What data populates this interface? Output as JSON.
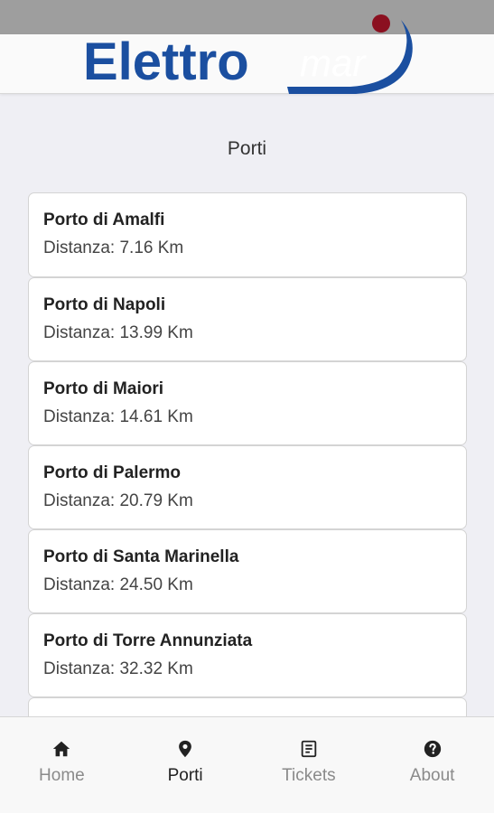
{
  "app": {
    "brand_part1": "Elettro",
    "brand_part2": "mar"
  },
  "page": {
    "title": "Porti"
  },
  "ports": [
    {
      "name": "Porto di Amalfi",
      "distance": "Distanza: 7.16 Km"
    },
    {
      "name": "Porto di Napoli",
      "distance": "Distanza: 13.99 Km"
    },
    {
      "name": "Porto di Maiori",
      "distance": "Distanza: 14.61 Km"
    },
    {
      "name": "Porto di Palermo",
      "distance": "Distanza: 20.79 Km"
    },
    {
      "name": "Porto di Santa Marinella",
      "distance": "Distanza: 24.50 Km"
    },
    {
      "name": "Porto di Torre Annunziata",
      "distance": "Distanza: 32.32 Km"
    }
  ],
  "tabbar": {
    "items": [
      {
        "label": "Home",
        "icon": "home-icon"
      },
      {
        "label": "Porti",
        "icon": "location-pin-icon",
        "active": true
      },
      {
        "label": "Tickets",
        "icon": "ticket-icon"
      },
      {
        "label": "About",
        "icon": "help-icon"
      }
    ]
  },
  "colors": {
    "brand_blue": "#1b4fa0",
    "brand_red": "#8b1020",
    "background": "#efeff4"
  }
}
